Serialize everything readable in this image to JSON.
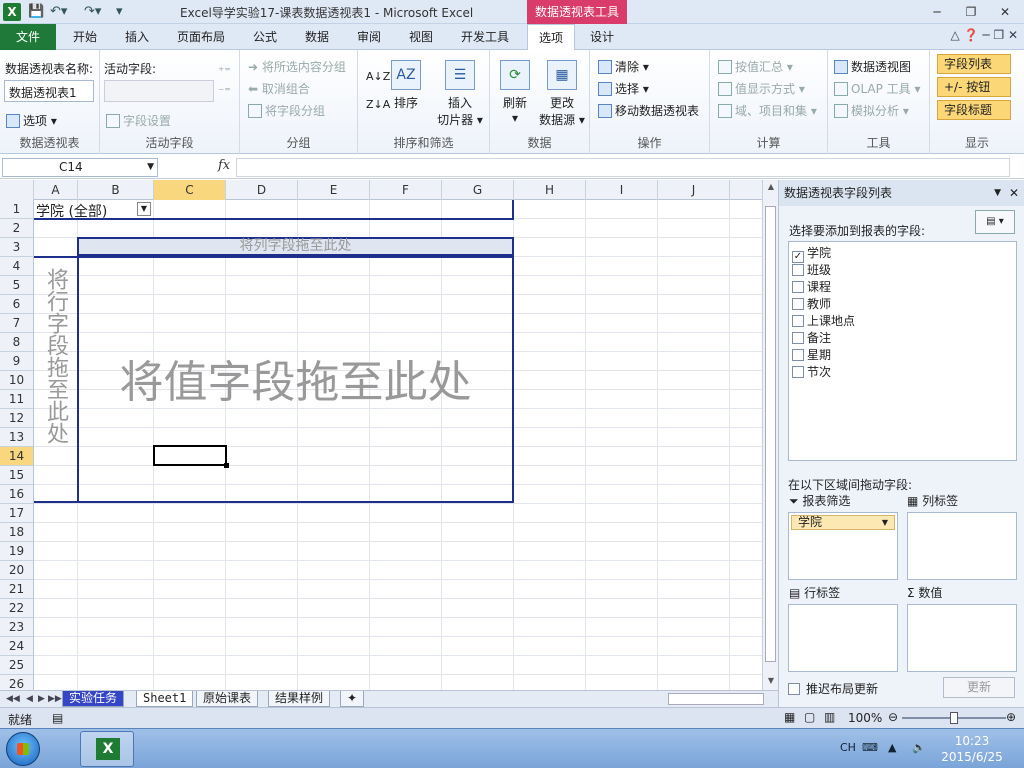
{
  "window": {
    "app_icon": "X",
    "title": "Excel导学实验17-课表数据透视表1  -  Microsoft Excel",
    "context_tools": "数据透视表工具",
    "qat_icons": [
      "save-icon",
      "undo-icon",
      "redo-icon",
      "customize-icon"
    ]
  },
  "tabs": [
    "文件",
    "开始",
    "插入",
    "页面布局",
    "公式",
    "数据",
    "审阅",
    "视图",
    "开发工具",
    "选项",
    "设计"
  ],
  "ribbon": {
    "pivot_name_label": "数据透视表名称:",
    "pivot_name_value": "数据透视表1",
    "options_btn": "选项",
    "group_pivot": "数据透视表",
    "active_field_label": "活动字段:",
    "field_settings": "字段设置",
    "group_active_field": "活动字段",
    "group_selection": "将所选内容分组",
    "ungroup": "取消组合",
    "group_field": "将字段分组",
    "group_grouping": "分组",
    "sort": "排序",
    "insert_slicer_1": "插入",
    "insert_slicer_2": "切片器",
    "group_sort_filter": "排序和筛选",
    "refresh": "刷新",
    "change_source_1": "更改",
    "change_source_2": "数据源",
    "group_data": "数据",
    "clear": "清除",
    "select": "选择",
    "move_pivot": "移动数据透视表",
    "group_actions": "操作",
    "summarize_by": "按值汇总",
    "show_values_as": "值显示方式",
    "fields_items_sets": "域、项目和集",
    "group_calc": "计算",
    "pivot_chart": "数据透视图",
    "olap_tools": "OLAP 工具",
    "what_if": "模拟分析",
    "group_tools": "工具",
    "field_list": "字段列表",
    "plus_minus": "+/- 按钮",
    "field_headers": "字段标题",
    "group_show": "显示"
  },
  "formula_bar": {
    "name_box": "C14",
    "fx": "fx",
    "formula": ""
  },
  "grid": {
    "columns": [
      "A",
      "B",
      "C",
      "D",
      "E",
      "F",
      "G",
      "H",
      "I",
      "J"
    ],
    "selected_column": "C",
    "rows": [
      "1",
      "2",
      "3",
      "4",
      "5",
      "6",
      "7",
      "8",
      "9",
      "10",
      "11",
      "12",
      "13",
      "14",
      "15",
      "16",
      "17",
      "18",
      "19",
      "20",
      "21",
      "22",
      "23",
      "24",
      "25",
      "26"
    ],
    "selected_row": "14",
    "filter_label": "学院  (全部)",
    "col_drop_text": "将列字段拖至此处",
    "row_drop_text": "将行字段拖至此处",
    "value_drop_text": "将值字段拖至此处"
  },
  "sheet_tabs": [
    "实验任务",
    "Sheet1",
    "原始课表",
    "结果样例"
  ],
  "status": {
    "ready": "就绪",
    "zoom": "100%"
  },
  "field_pane": {
    "title": "数据透视表字段列表",
    "choose_label": "选择要添加到报表的字段:",
    "fields": [
      {
        "name": "学院",
        "checked": true
      },
      {
        "name": "班级",
        "checked": false
      },
      {
        "name": "课程",
        "checked": false
      },
      {
        "name": "教师",
        "checked": false
      },
      {
        "name": "上课地点",
        "checked": false
      },
      {
        "name": "备注",
        "checked": false
      },
      {
        "name": "星期",
        "checked": false
      },
      {
        "name": "节次",
        "checked": false
      }
    ],
    "drag_label": "在以下区域间拖动字段:",
    "report_filter": "报表筛选",
    "column_labels": "列标签",
    "row_labels": "行标签",
    "values": "数值",
    "filter_chip": "学院",
    "defer_update": "推迟布局更新",
    "update_btn": "更新"
  },
  "taskbar": {
    "lang": "CH",
    "time": "10:23",
    "date": "2015/6/25"
  }
}
